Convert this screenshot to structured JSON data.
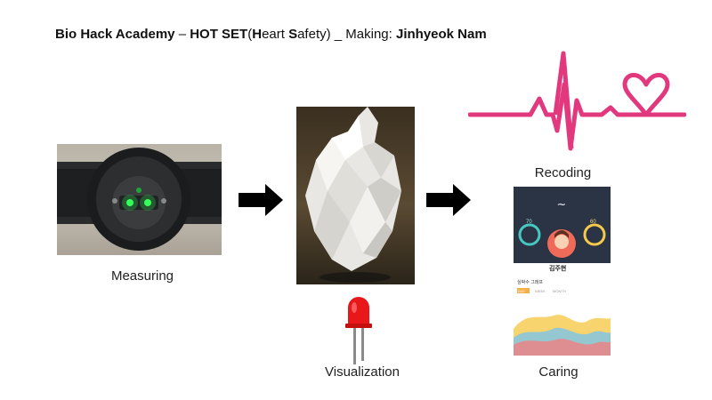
{
  "title": {
    "academy": "Bio Hack Academy",
    "dash": "–",
    "project": "HOT SET",
    "paren_open": "(",
    "h": "H",
    "eart": "eart ",
    "s": "S",
    "afety": "afety) _ Making: ",
    "author": "Jinhyeok Nam"
  },
  "steps": {
    "measuring": "Measuring",
    "visualization": "Visualization",
    "recording": "Recoding",
    "caring": "Caring"
  },
  "app": {
    "name": "김주현",
    "tabs": [
      "DAY",
      "WEEK",
      "MONTH"
    ],
    "left_value": "70",
    "right_value": "60",
    "section_title": "심박수 그래프"
  },
  "colors": {
    "heartbeat": "#e2387e",
    "led": "#e8181a",
    "arrow": "#000000",
    "app_header": "#2b3445"
  }
}
